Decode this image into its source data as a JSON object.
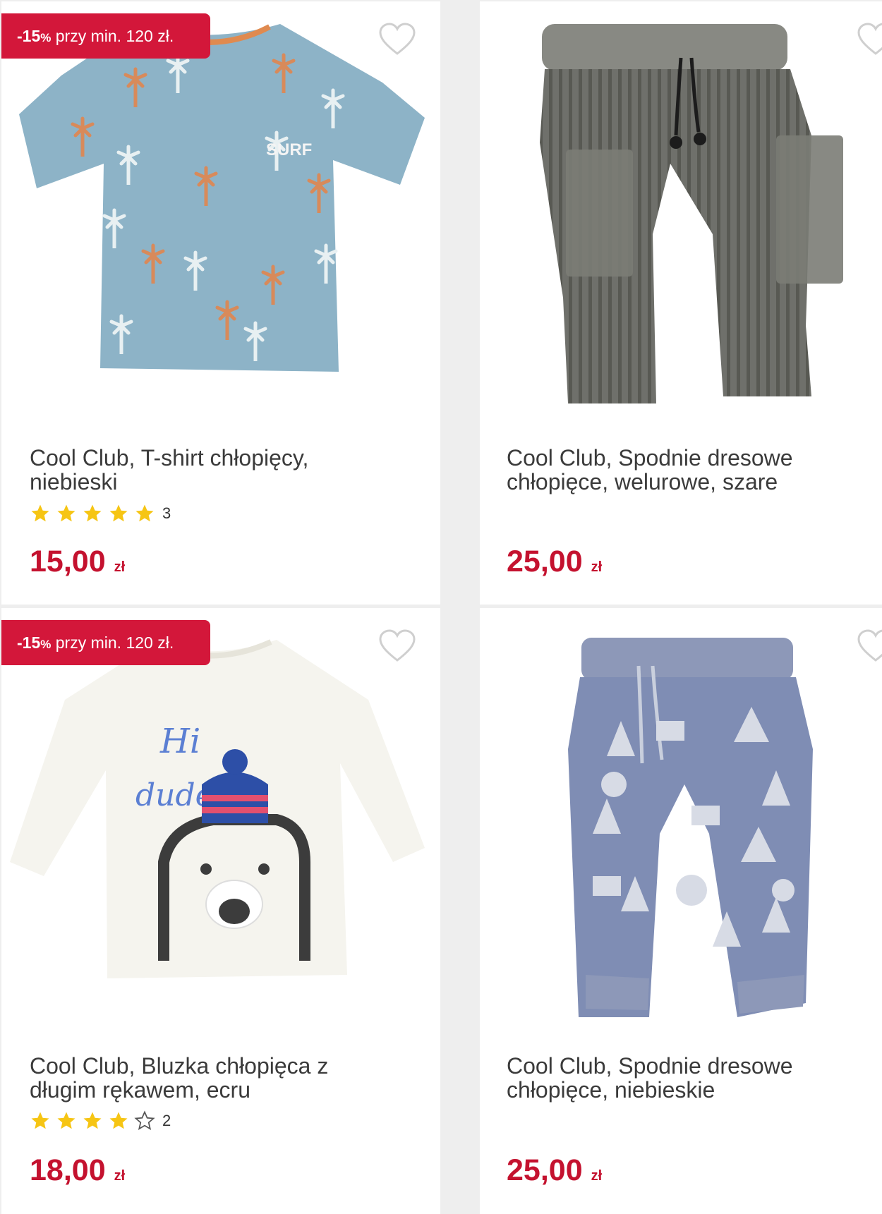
{
  "products": [
    {
      "badge": {
        "pct": "-15",
        "pct_sign": "%",
        "text": "przy min. 120 zł."
      },
      "title_line1": "Cool Club, T-shirt chłopięcy,",
      "title_line2": "niebieski",
      "rating": 5,
      "rating_count": "3",
      "price": "15,00",
      "currency": "zł",
      "image_label": "SURF"
    },
    {
      "title_line1": "Cool Club, Spodnie dresowe",
      "title_line2": "chłopięce, welurowe, szare",
      "price": "25,00",
      "currency": "zł"
    },
    {
      "badge": {
        "pct": "-15",
        "pct_sign": "%",
        "text": "przy min. 120 zł."
      },
      "title_line1": "Cool Club, Bluzka chłopięca z",
      "title_line2": "długim rękawem, ecru",
      "rating": 4,
      "rating_count": "2",
      "price": "18,00",
      "currency": "zł",
      "image_label_1": "Hi",
      "image_label_2": "dude!"
    },
    {
      "title_line1": "Cool Club, Spodnie dresowe",
      "title_line2": "chłopięce, niebieskie",
      "price": "25,00",
      "currency": "zł"
    }
  ],
  "colors": {
    "accent": "#d3173a",
    "price": "#c4122f",
    "star": "#f6c514"
  },
  "icons": {
    "wishlist": "heart-icon",
    "rating": "star-icon"
  }
}
